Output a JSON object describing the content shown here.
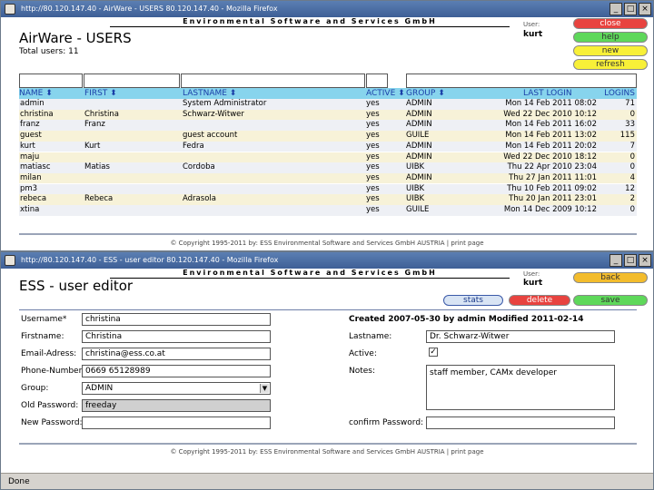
{
  "win1": {
    "title": "http://80.120.147.40 - AirWare - USERS 80.120.147.40 - Mozilla Firefox",
    "org": "Environmental Software and Services GmbH",
    "user_label": "User:",
    "user": "kurt",
    "buttons": {
      "close": "close",
      "help": "help",
      "new": "new",
      "refresh": "refresh"
    },
    "page_title": "AirWare - USERS",
    "total_users": "Total users: 11",
    "columns": [
      "NAME",
      "FIRST",
      "LASTNAME",
      "ACTIVE",
      "GROUP",
      "LAST LOGIN",
      "LOGINS"
    ],
    "rows": [
      [
        "admin",
        "",
        "System Administrator",
        "yes",
        "ADMIN",
        "Mon 14 Feb 2011 08:02",
        "71"
      ],
      [
        "christina",
        "Christina",
        "Schwarz-Witwer",
        "yes",
        "ADMIN",
        "Wed 22 Dec 2010 10:12",
        "0"
      ],
      [
        "franz",
        "Franz",
        "",
        "yes",
        "ADMIN",
        "Mon 14 Feb 2011 16:02",
        "33"
      ],
      [
        "guest",
        "",
        "guest account",
        "yes",
        "GUILE",
        "Mon 14 Feb 2011 13:02",
        "115"
      ],
      [
        "kurt",
        "Kurt",
        "Fedra",
        "yes",
        "ADMIN",
        "Mon 14 Feb 2011 20:02",
        "7"
      ],
      [
        "maju",
        "",
        "",
        "yes",
        "ADMIN",
        "Wed 22 Dec 2010 18:12",
        "0"
      ],
      [
        "matiasc",
        "Matias",
        "Cordoba",
        "yes",
        "UIBK",
        "Thu 22 Apr 2010 23:04",
        "0"
      ],
      [
        "milan",
        "",
        "",
        "yes",
        "ADMIN",
        "Thu 27 Jan 2011 11:01",
        "4"
      ],
      [
        "pm3",
        "",
        "",
        "yes",
        "UIBK",
        "Thu 10 Feb 2011 09:02",
        "12"
      ],
      [
        "rebeca",
        "Rebeca",
        "Adrasola",
        "yes",
        "UIBK",
        "Thu 20 Jan 2011 23:01",
        "2"
      ],
      [
        "xtina",
        "",
        "",
        "yes",
        "GUILE",
        "Mon 14 Dec 2009 10:12",
        "0"
      ]
    ],
    "footer": "© Copyright 1995-2011 by:  ESS  Environmental Software and Services GmbH AUSTRIA  |  print page"
  },
  "win2": {
    "title": "http://80.120.147.40 - ESS - user editor 80.120.147.40 - Mozilla Firefox",
    "org": "Environmental Software and Services GmbH",
    "user_label": "User:",
    "user": "kurt",
    "buttons": {
      "back": "back",
      "stats": "stats",
      "delete": "delete",
      "save": "save"
    },
    "page_title": "ESS - user editor",
    "created": "Created 2007-05-30 by admin  Modified 2011-02-14",
    "fields": {
      "username_label": "Username*",
      "username": "christina",
      "firstname_label": "Firstname:",
      "firstname": "Christina",
      "email_label": "Email-Adress:",
      "email": "christina@ess.co.at",
      "phone_label": "Phone-Number:",
      "phone": "0669 65128989",
      "group_label": "Group:",
      "group": "ADMIN",
      "oldpw_label": "Old Password:",
      "oldpw": "freeday",
      "newpw_label": "New Password:",
      "newpw": "",
      "lastname_label": "Lastname:",
      "lastname": "Dr. Schwarz-Witwer",
      "active_label": "Active:",
      "active_mark": "✓",
      "notes_label": "Notes:",
      "notes": "staff member, CAMx developer",
      "confirmpw_label": "confirm Password:",
      "confirmpw": ""
    },
    "footer": "© Copyright 1995-2011 by:  ESS  Environmental Software and Services GmbH AUSTRIA  |  print page",
    "status": "Done"
  }
}
